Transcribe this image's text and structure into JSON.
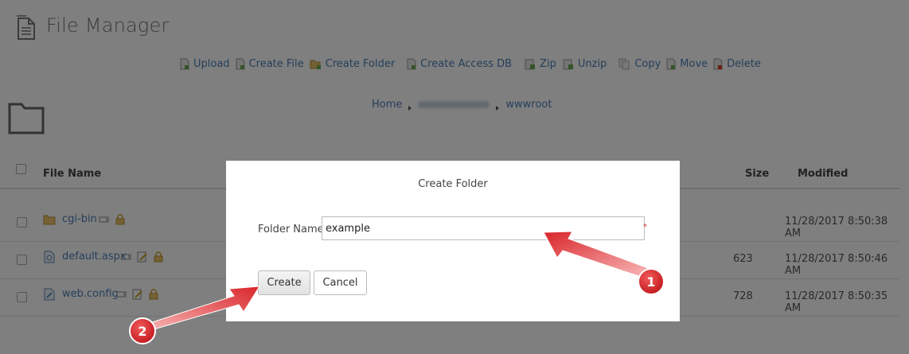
{
  "app": {
    "title": "File Manager"
  },
  "toolbar": {
    "upload": "Upload",
    "create_file": "Create File",
    "create_folder": "Create Folder",
    "create_access_db": "Create Access DB",
    "zip": "Zip",
    "unzip": "Unzip",
    "copy": "Copy",
    "move": "Move",
    "delete": "Delete"
  },
  "breadcrumb": {
    "home": "Home",
    "current": "wwwroot"
  },
  "table": {
    "headers": {
      "name": "File Name",
      "size": "Size",
      "modified": "Modified"
    },
    "rows": [
      {
        "name": "cgi-bin",
        "type": "folder",
        "size": "",
        "modified": "11/28/2017 8:50:38 AM"
      },
      {
        "name": "default.aspx",
        "type": "aspx",
        "size": "623",
        "modified": "11/28/2017 8:50:46 AM"
      },
      {
        "name": "web.config",
        "type": "config",
        "size": "728",
        "modified": "11/28/2017 8:50:35 AM"
      }
    ]
  },
  "dialog": {
    "title": "Create Folder",
    "field_label": "Folder Name:",
    "field_value": "example",
    "required_mark": "*",
    "create_label": "Create",
    "cancel_label": "Cancel"
  },
  "annotations": {
    "step1": "1",
    "step2": "2"
  },
  "colors": {
    "link": "#4a7fb5",
    "badge": "#d9252a",
    "overlay": "rgba(0,0,0,0.5)"
  }
}
